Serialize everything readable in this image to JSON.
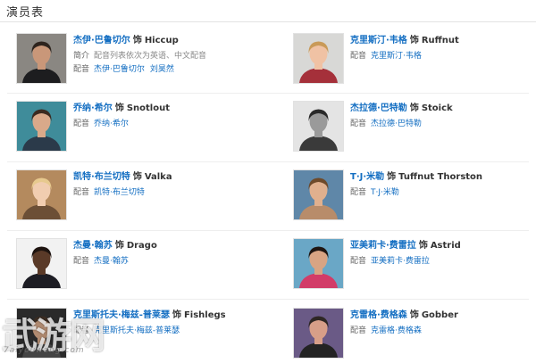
{
  "page": {
    "title": "演员表"
  },
  "labels": {
    "as": "饰",
    "intro": "简介",
    "dub": "配音"
  },
  "cast": [
    {
      "actor": "杰伊·巴鲁切尔",
      "role": "Hiccup",
      "intro": "配音列表依次为英语、中文配音",
      "dubbers": [
        "杰伊·巴鲁切尔",
        "刘昊然"
      ],
      "photo": {
        "bg": "#8a8782",
        "skin": "#c99779",
        "hair": "#2e241e",
        "shirt": "#1d1d1f"
      }
    },
    {
      "actor": "克里斯汀·韦格",
      "role": "Ruffnut",
      "dubbers": [
        "克里斯汀·韦格"
      ],
      "photo": {
        "bg": "#d8d8d6",
        "skin": "#f0c2a4",
        "hair": "#c99a58",
        "shirt": "#a5303a"
      }
    },
    {
      "actor": "乔纳·希尔",
      "role": "Snotlout",
      "dubbers": [
        "乔纳·希尔"
      ],
      "photo": {
        "bg": "#3f8c9a",
        "skin": "#d9a98a",
        "hair": "#3a2a20",
        "shirt": "#2b3a4a"
      }
    },
    {
      "actor": "杰拉德·巴特勒",
      "role": "Stoick",
      "dubbers": [
        "杰拉德·巴特勒"
      ],
      "photo": {
        "bg": "#e4e4e4",
        "skin": "#9a9a9a",
        "hair": "#2a2a2a",
        "shirt": "#3a3a3a"
      }
    },
    {
      "actor": "凯特·布兰切特",
      "role": "Valka",
      "dubbers": [
        "凯特·布兰切特"
      ],
      "photo": {
        "bg": "#b48a5e",
        "skin": "#f1cdb0",
        "hair": "#e7c98e",
        "shirt": "#6c4f36"
      }
    },
    {
      "actor": "T·J·米勒",
      "role": "Tuffnut Thorston",
      "dubbers": [
        "T·J·米勒"
      ],
      "photo": {
        "bg": "#5f87a8",
        "skin": "#e0b08e",
        "hair": "#6e4a2a",
        "shirt": "#b88c6a"
      }
    },
    {
      "actor": "杰曼·翰苏",
      "role": "Drago",
      "dubbers": [
        "杰曼·翰苏"
      ],
      "photo": {
        "bg": "#f2f2f2",
        "skin": "#5a3a28",
        "hair": "#1e1410",
        "shirt": "#1d1d24"
      }
    },
    {
      "actor": "亚美莉卡·费雷拉",
      "role": "Astrid",
      "dubbers": [
        "亚美莉卡·费雷拉"
      ],
      "photo": {
        "bg": "#6aa7c6",
        "skin": "#d8a483",
        "hair": "#1f1612",
        "shirt": "#d23c68"
      }
    },
    {
      "actor": "克里斯托夫·梅兹-普莱瑟",
      "role": "Fishlegs",
      "dubbers": [
        "克里斯托夫·梅兹-普莱瑟"
      ],
      "photo": {
        "bg": "#2a2a2a",
        "skin": "#b08a70",
        "hair": "#3a2c22",
        "shirt": "#444444"
      }
    },
    {
      "actor": "克雷格·费格森",
      "role": "Gobber",
      "dubbers": [
        "克雷格·费格森"
      ],
      "photo": {
        "bg": "#6a5a86",
        "skin": "#d79f88",
        "hair": "#2e2724",
        "shirt": "#232323"
      }
    }
  ],
  "watermark": {
    "text": "武游网",
    "url": "7aiyouwang.com"
  }
}
